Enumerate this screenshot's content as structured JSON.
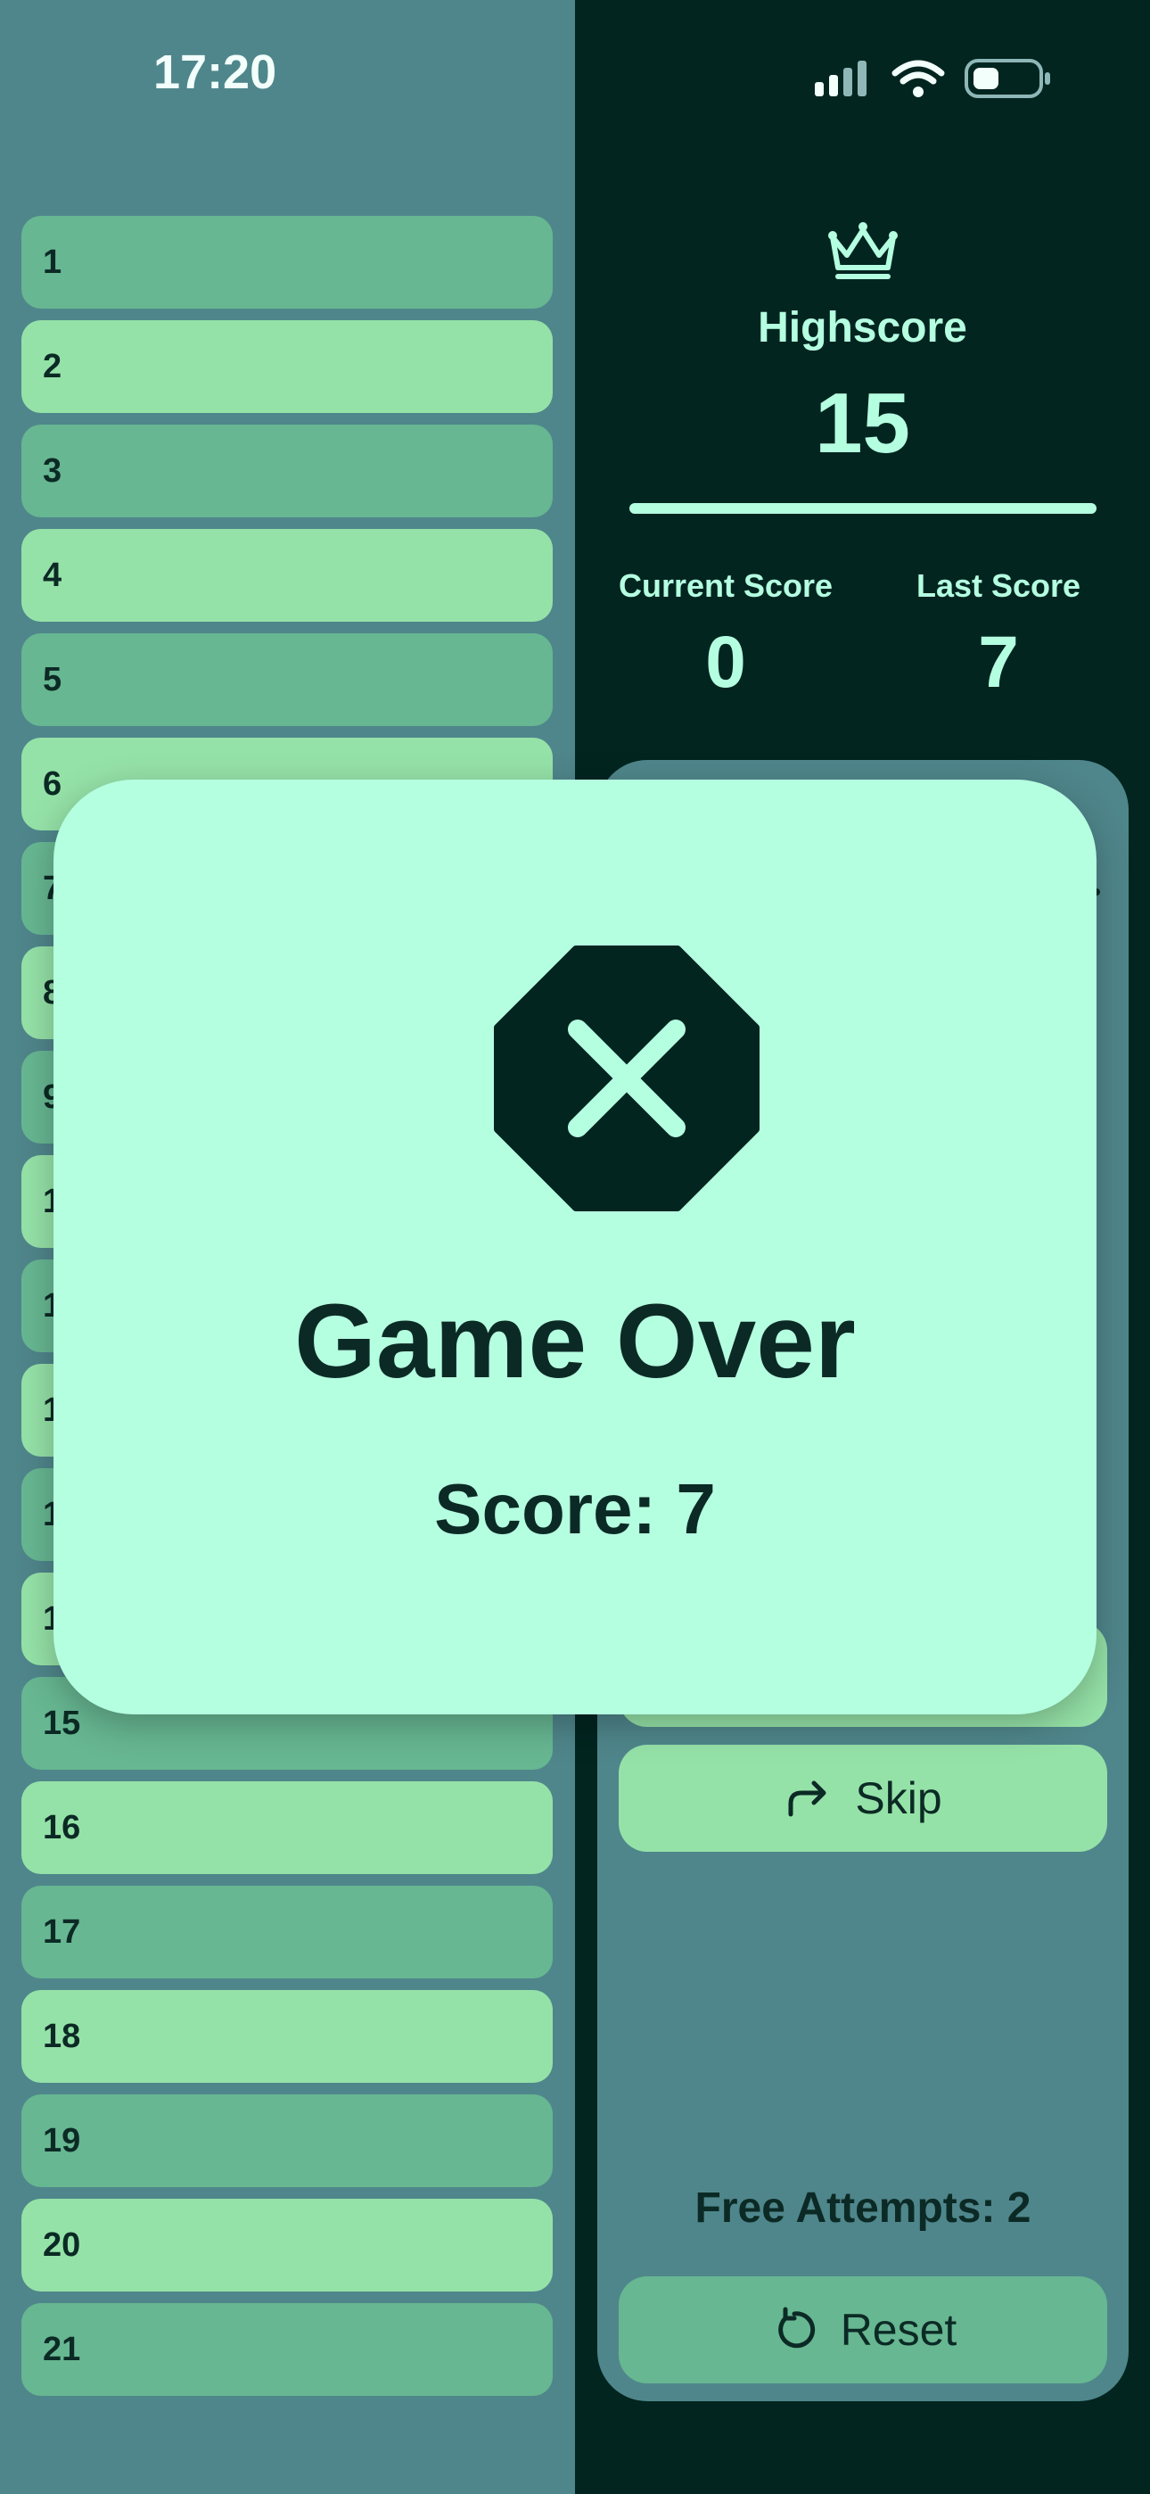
{
  "status_bar": {
    "time": "17:20",
    "icons": [
      "signal-icon",
      "wifi-icon",
      "battery-icon"
    ]
  },
  "list": {
    "items": [
      "1",
      "2",
      "3",
      "4",
      "5",
      "6",
      "7",
      "8",
      "9",
      "10",
      "11",
      "12",
      "13",
      "14",
      "15",
      "16",
      "17",
      "18",
      "19",
      "20",
      "21"
    ]
  },
  "scores": {
    "highscore_label": "Highscore",
    "highscore_value": "15",
    "current_label": "Current Score",
    "current_value": "0",
    "last_label": "Last Score",
    "last_value": "7"
  },
  "controls": {
    "skip_label": "Skip",
    "free_attempts": "Free Attempts: 2",
    "reset_label": "Reset"
  },
  "modal": {
    "title": "Game Over",
    "score": "Score: 7",
    "icon": "game-over-icon"
  },
  "colors": {
    "dark": "#022520",
    "teal": "#4F868B",
    "mint": "#B5FFE1",
    "green_light": "#95E2A8",
    "green_mid": "#67B792",
    "text_dark": "#0C2A25"
  }
}
